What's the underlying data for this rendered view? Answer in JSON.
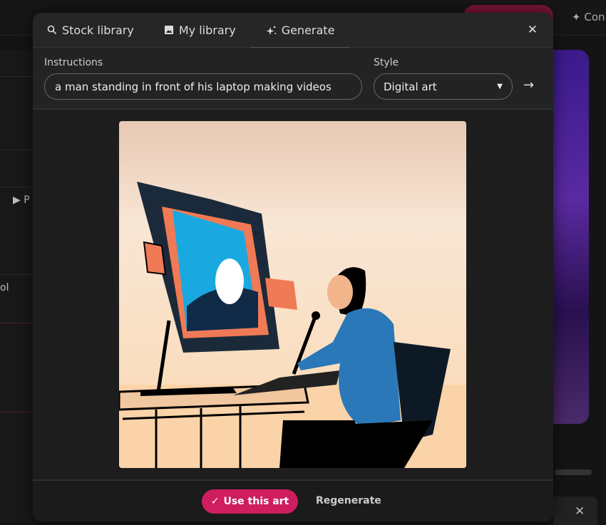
{
  "background": {
    "top_right_label": "Con",
    "left_fragment_1": "P",
    "left_fragment_2": "ol"
  },
  "tabs": [
    {
      "label": "Stock library",
      "icon": "search-icon"
    },
    {
      "label": "My library",
      "icon": "image-icon"
    },
    {
      "label": "Generate",
      "icon": "sparkle-icon",
      "active": true
    }
  ],
  "form": {
    "instructions_label": "Instructions",
    "instructions_value": "a man standing in front of his laptop making videos",
    "style_label": "Style",
    "style_value": "Digital art"
  },
  "footer": {
    "use_label": "Use this art",
    "regenerate_label": "Regenerate"
  },
  "colors": {
    "accent": "#cf1d5f",
    "modal_bg": "#1d1d1d"
  }
}
